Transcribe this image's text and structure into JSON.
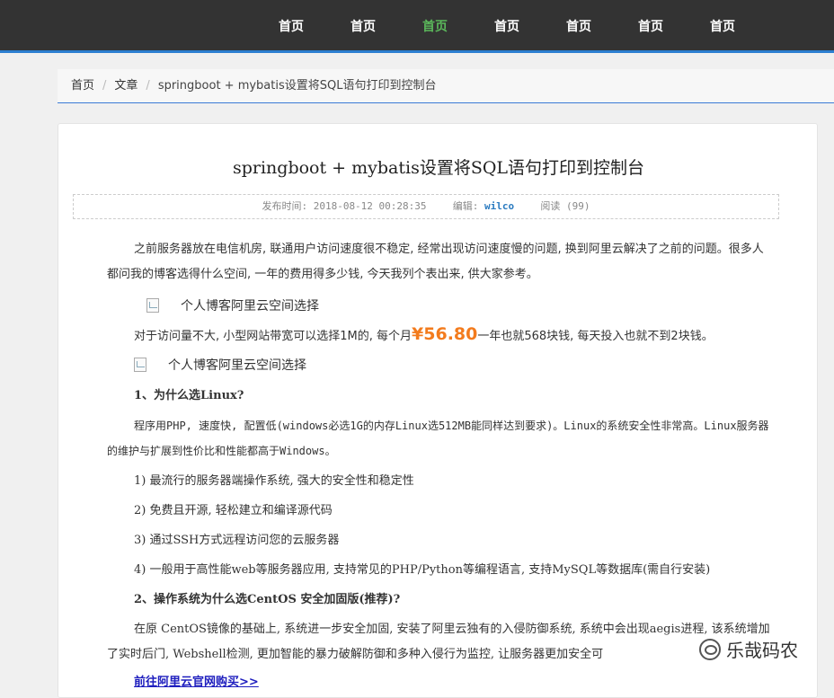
{
  "nav": {
    "items": [
      {
        "label": "首页",
        "active": false
      },
      {
        "label": "首页",
        "active": false
      },
      {
        "label": "首页",
        "active": true
      },
      {
        "label": "首页",
        "active": false
      },
      {
        "label": "首页",
        "active": false
      },
      {
        "label": "首页",
        "active": false
      },
      {
        "label": "首页",
        "active": false
      }
    ],
    "active_color": "#5bb75b",
    "bar_color": "#333333",
    "accent_border": "#2c7fd1"
  },
  "breadcrumb": {
    "home": "首页",
    "section": "文章",
    "current": "springboot + mybatis设置将SQL语句打印到控制台",
    "separator": "/"
  },
  "article": {
    "title": "springboot + mybatis设置将SQL语句打印到控制台",
    "meta": {
      "published_label": "发布时间:",
      "published_value": "2018-08-12 00:28:35",
      "editor_label": "编辑:",
      "editor_value": "wilco",
      "views_label": "阅读",
      "views_value": "(99)"
    },
    "p1": "之前服务器放在电信机房, 联通用户访问速度很不稳定, 经常出现访问速度慢的问题, 换到阿里云解决了之前的问题。很多人都问我的博客选得什么空间, 一年的费用得多少钱, 今天我列个表出来, 供大家参考。",
    "img1_alt": "个人博客阿里云空间选择",
    "p2_before": "对于访问量不大, 小型网站带宽可以选择1M的, 每个月",
    "price": "¥56.80",
    "p2_after": "一年也就568块钱, 每天投入也就不到2块钱。",
    "img2_alt": "个人博客阿里云空间选择",
    "h1": "1、为什么选Linux?",
    "p3": "程序用PHP, 速度快, 配置低(windows必选1G的内存Linux选512MB能同样达到要求)。Linux的系统安全性非常高。Linux服务器的维护与扩展到性价比和性能都高于Windows。",
    "list": [
      "1) 最流行的服务器端操作系统, 强大的安全性和稳定性",
      "2) 免费且开源, 轻松建立和编译源代码",
      "3) 通过SSH方式远程访问您的云服务器",
      "4) 一般用于高性能web等服务器应用, 支持常见的PHP/Python等编程语言, 支持MySQL等数据库(需自行安装)"
    ],
    "h2": "2、操作系统为什么选CentOS 安全加固版(推荐)?",
    "p4": "在原 CentOS镜像的基础上, 系统进一步安全加固, 安装了阿里云独有的入侵防御系统, 系统中会出现aegis进程, 该系统增加了实时后门, Webshell检测, 更加智能的暴力破解防御和多种入侵行为监控, 让服务器更加安全可",
    "cta": "前往阿里云官网购买>>",
    "price_color": "#f37b1d"
  },
  "watermark": {
    "text": "乐哉码农"
  }
}
